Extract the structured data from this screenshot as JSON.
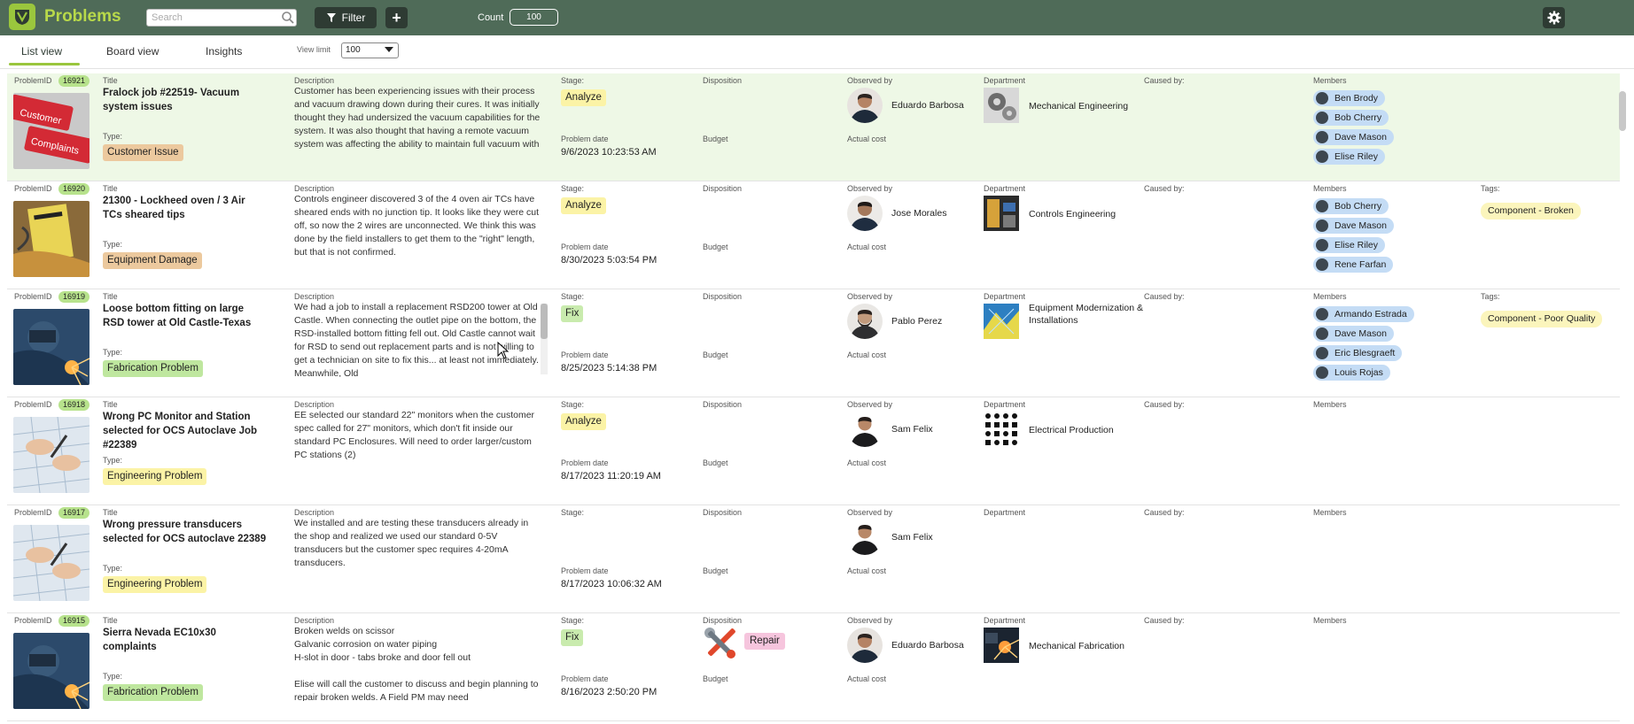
{
  "app": {
    "title": "Problems"
  },
  "toolbar": {
    "search_placeholder": "Search",
    "filter_label": "Filter",
    "add_label": "+",
    "count_label": "Count",
    "count_value": "100"
  },
  "tabs": [
    {
      "label": "List view",
      "active": true
    },
    {
      "label": "Board view",
      "active": false
    },
    {
      "label": "Insights",
      "active": false
    }
  ],
  "view_limit": {
    "label": "View limit",
    "value": "100"
  },
  "field_labels": {
    "problem_id": "ProblemID",
    "title": "Title",
    "type": "Type:",
    "description": "Description",
    "stage": "Stage:",
    "problem_date": "Problem date",
    "disposition": "Disposition",
    "budget": "Budget",
    "observed_by": "Observed by",
    "actual_cost": "Actual cost",
    "department": "Department",
    "caused_by": "Caused by:",
    "members": "Members",
    "tags": "Tags:"
  },
  "colors": {
    "header_bg": "#4f6b58",
    "accent_green": "#9ac63d",
    "badge_analyze": "#fbf3a6",
    "badge_fix": "#c9ebae",
    "type_customer_issue": "#ecc99e",
    "type_equipment_damage": "#ecc99e",
    "type_fabrication": "#bfe79f",
    "type_engineering": "#fbf3a6",
    "member_chip": "#c4dcf5",
    "tag_chip": "#fbf5bc",
    "disposition_repair": "#f6c5dd"
  },
  "problems": [
    {
      "id": "16921",
      "title": "Fralock job #22519- Vacuum system issues",
      "type": "Customer Issue",
      "type_color": "#ecc99e",
      "description": "Customer has been experiencing issues with their process and vacuum drawing down during their cures. It was initially thought they had undersized the vacuum capabilities for the system. It was also thought that having a remote vacuum system was affecting the ability to maintain full vacuum with",
      "stage": "Analyze",
      "stage_color": "#fbf3a6",
      "problem_date": "9/6/2023 10:23:53 AM",
      "observed_by": "Eduardo Barbosa",
      "department": "Mechanical Engineering",
      "members": [
        "Ben Brody",
        "Bob Cherry",
        "Dave Mason",
        "Elise Riley"
      ],
      "tag": "",
      "disposition": "",
      "image_icon": "customer-complaints-keyboard-image"
    },
    {
      "id": "16920",
      "title": "21300 - Lockheed oven / 3 Air TCs sheared tips",
      "type": "Equipment Damage",
      "type_color": "#ecc99e",
      "description": "Controls engineer discovered 3 of the 4 oven air TCs have sheared ends with no junction tip. It looks like they were cut off, so now the 2 wires are unconnected. We think this was done by the field installers to get them to the \"right\" length, but that is not confirmed.",
      "stage": "Analyze",
      "stage_color": "#fbf3a6",
      "problem_date": "8/30/2023 5:03:54 PM",
      "observed_by": "Jose Morales",
      "department": "Controls Engineering",
      "members": [
        "Bob Cherry",
        "Dave Mason",
        "Elise Riley",
        "Rene Farfan"
      ],
      "tag": "Component - Broken",
      "disposition": "",
      "image_icon": "equipment-damage-image"
    },
    {
      "id": "16919",
      "title": "Loose bottom fitting on large RSD tower at Old Castle-Texas",
      "type": "Fabrication Problem",
      "type_color": "#bfe79f",
      "description": "We had a job to install a replacement RSD200 tower at Old Castle. When connecting the outlet pipe on the bottom, the RSD-installed bottom fitting fell out. Old Castle cannot wait for RSD to send out replacement parts and is not willing to get a technician on site to fix this... at least not immediately. Meanwhile, Old",
      "stage": "Fix",
      "stage_color": "#c9ebae",
      "problem_date": "8/25/2023 5:14:38 PM",
      "observed_by": "Pablo Perez",
      "department": "Equipment Modernization & Installations",
      "members": [
        "Armando Estrada",
        "Dave Mason",
        "Eric Blesgraeft",
        "Louis Rojas"
      ],
      "tag": "Component - Poor Quality",
      "disposition": "",
      "image_icon": "welding-image"
    },
    {
      "id": "16918",
      "title": "Wrong PC Monitor and Station selected for OCS Autoclave Job #22389",
      "type": "Engineering Problem",
      "type_color": "#fbf3a6",
      "description": "EE selected our standard 22\" monitors when the customer spec called for 27\" monitors, which don't fit inside our standard PC Enclosures. Will need to order larger/custom PC stations (2)",
      "stage": "Analyze",
      "stage_color": "#fbf3a6",
      "problem_date": "8/17/2023 11:20:19 AM",
      "observed_by": "Sam Felix",
      "department": "Electrical Production",
      "members": [],
      "tag": "",
      "disposition": "",
      "image_icon": "blueprints-image"
    },
    {
      "id": "16917",
      "title": "Wrong pressure transducers selected for OCS autoclave 22389",
      "type": "Engineering Problem",
      "type_color": "#fbf3a6",
      "description": "We installed and are testing these transducers already in the shop and realized we used our standard 0-5V transducers but the customer spec requires 4-20mA transducers.",
      "stage": "",
      "stage_color": "",
      "problem_date": "8/17/2023 10:06:32 AM",
      "observed_by": "Sam Felix",
      "department": "",
      "members": [],
      "tag": "",
      "disposition": "",
      "image_icon": "blueprints-image"
    },
    {
      "id": "16915",
      "title": "Sierra Nevada EC10x30 complaints",
      "type": "Fabrication Problem",
      "type_color": "#bfe79f",
      "description": "Broken welds on scissor\nGalvanic corrosion on water piping\nH-slot in door - tabs broke and door fell out\n\nElise will call the customer to discuss and begin planning to repair broken welds. A Field PM may need",
      "stage": "Fix",
      "stage_color": "#c9ebae",
      "problem_date": "8/16/2023 2:50:20 PM",
      "observed_by": "Eduardo Barbosa",
      "department": "Mechanical Fabrication",
      "members": [],
      "tag": "",
      "disposition": "Repair",
      "image_icon": "welding-image"
    }
  ]
}
